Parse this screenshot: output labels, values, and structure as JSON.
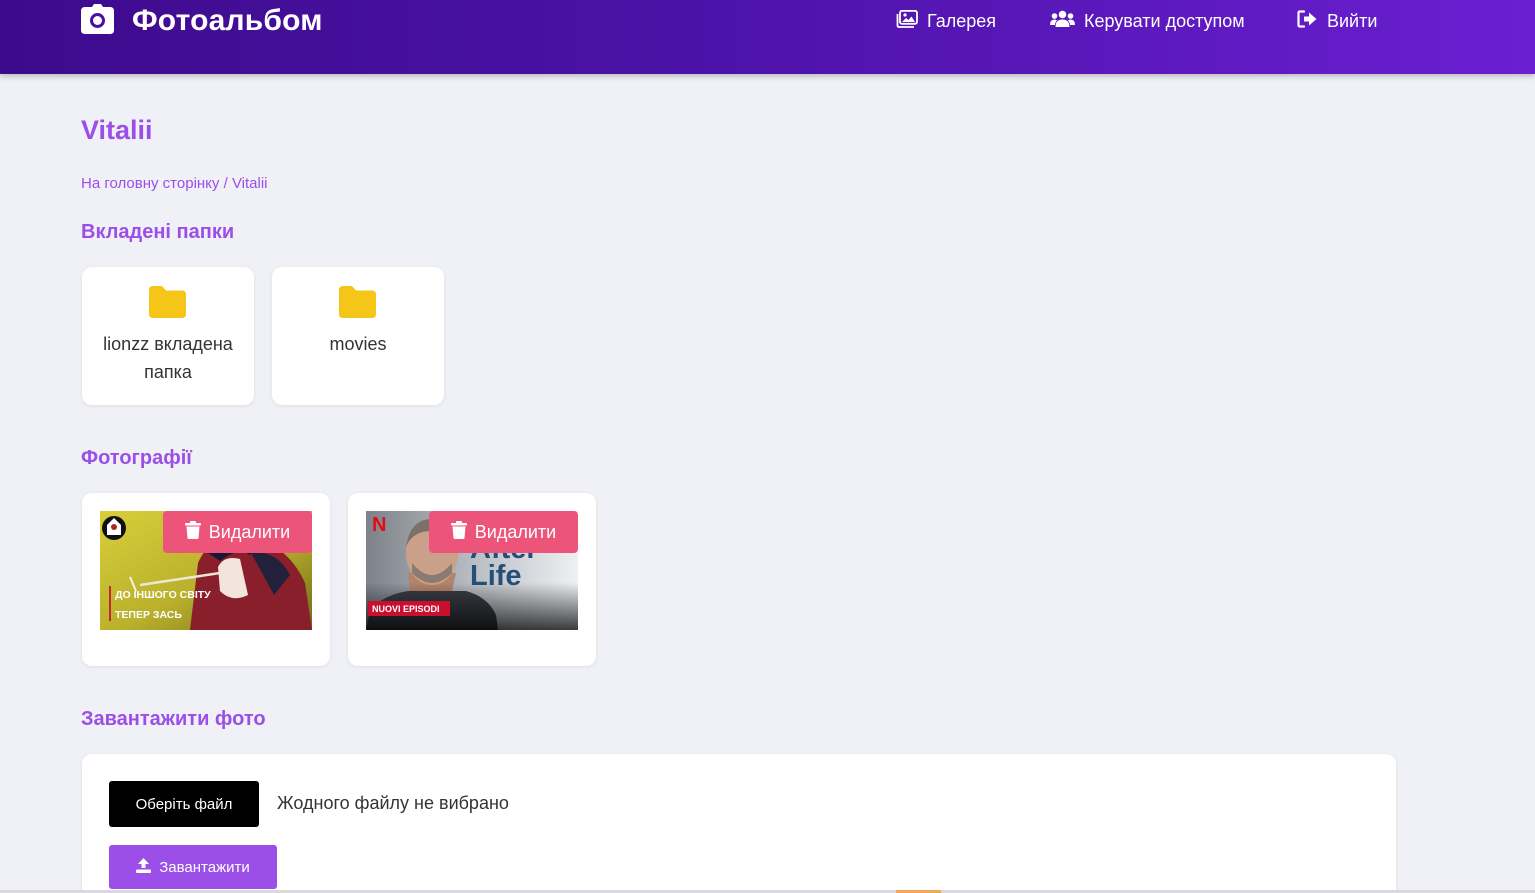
{
  "header": {
    "brand": "Фотоальбом",
    "nav": [
      {
        "label": "Галерея",
        "icon": "images-icon"
      },
      {
        "label": "Керувати доступом",
        "icon": "users-icon"
      },
      {
        "label": "Вийти",
        "icon": "sign-out-icon"
      }
    ]
  },
  "page": {
    "title": "Vitalii",
    "breadcrumb": {
      "home": "На головну сторінку",
      "separator": "/",
      "current": "Vitalii"
    }
  },
  "folders": {
    "heading": "Вкладені папки",
    "items": [
      {
        "name": "lionzz вкладена папка"
      },
      {
        "name": "movies"
      }
    ]
  },
  "photos": {
    "heading": "Фотографії",
    "delete_label": "Видалити",
    "items": [
      {
        "caption_line1": "ДО ІНШОГО СВІТУ",
        "caption_line2": "ТЕПЕР ЗАСЬ"
      },
      {
        "brand_letter": "N",
        "title_line1": "After",
        "title_line2": "Life",
        "badge": "NUOVI EPISODI"
      }
    ]
  },
  "upload": {
    "heading": "Завантажити фото",
    "choose_label": "Оберіть файл",
    "file_status": "Жодного файлу не вибрано",
    "submit_label": "Завантажити"
  },
  "colors": {
    "accent": "#9b4ee8",
    "delete": "#ec5579",
    "folder": "#f5c518",
    "header_start": "#3c0b8c",
    "header_end": "#6a1fd1"
  }
}
